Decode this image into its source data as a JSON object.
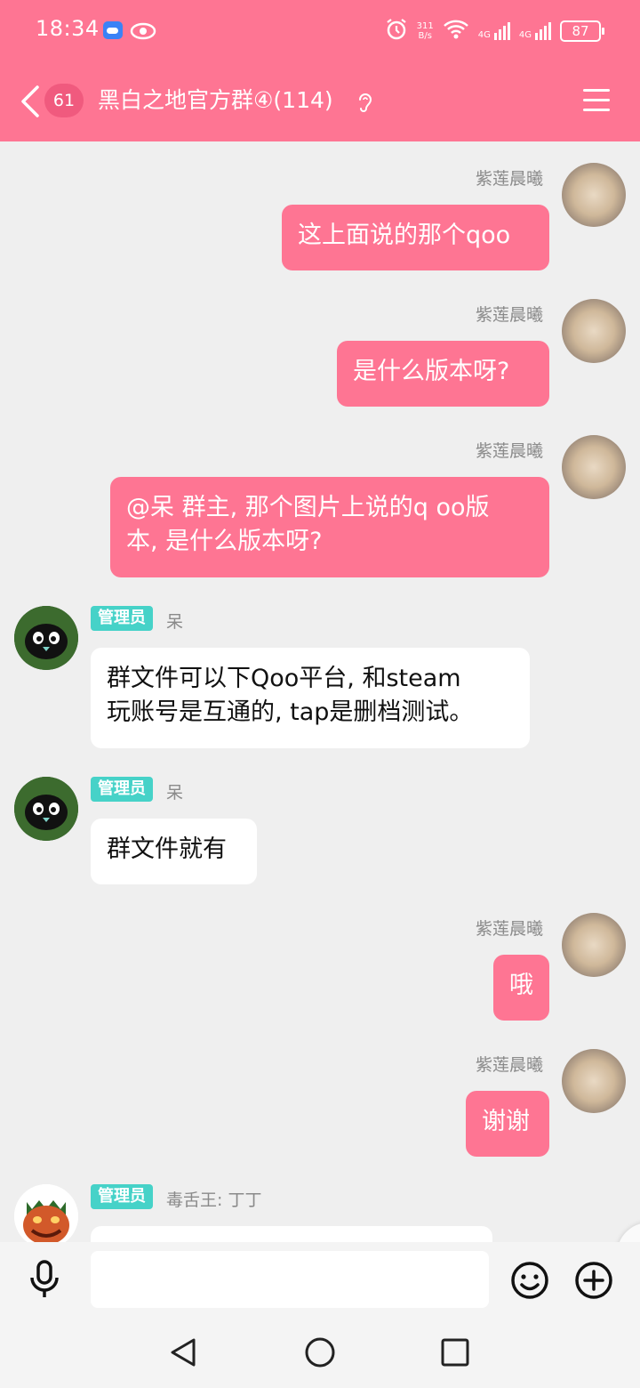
{
  "status": {
    "time": "18:34",
    "net_speed_top": "311",
    "net_speed_bottom": "B/s",
    "battery": "87",
    "sig1": "4G",
    "sig2": "4G"
  },
  "header": {
    "unread": "61",
    "title": "黑白之地官方群④(114)"
  },
  "messages": [
    {
      "side": "right",
      "sender": "紫莲晨曦",
      "text": "这上面说的那个qoo"
    },
    {
      "side": "right",
      "sender": "紫莲晨曦",
      "text": "是什么版本呀?"
    },
    {
      "side": "right",
      "sender": "紫莲晨曦",
      "text": "@呆 群主, 那个图片上说的q oo版\n本, 是什么版本呀?"
    },
    {
      "side": "left",
      "badge": "管理员",
      "sender": "呆",
      "text": "群文件可以下Qoo平台, 和steam\n玩账号是互通的, tap是删档测试。"
    },
    {
      "side": "left",
      "badge": "管理员",
      "sender": "呆",
      "text": "群文件就有"
    },
    {
      "side": "right",
      "sender": "紫莲晨曦",
      "text": "哦"
    },
    {
      "side": "right",
      "sender": "紫莲晨曦",
      "text": "谢谢"
    },
    {
      "side": "left",
      "badge": "管理员",
      "sender": "毒舌王: 丁丁",
      "text": ""
    }
  ],
  "input": {
    "placeholder": ""
  },
  "colors": {
    "accent": "#fe7593",
    "admin_badge": "#46d2c8",
    "background": "#efefef"
  },
  "icons": [
    "back-chevron-icon",
    "ear-icon",
    "menu-icon",
    "mic-icon",
    "emoji-icon",
    "plus-icon",
    "nav-back-icon",
    "nav-home-icon",
    "nav-recents-icon"
  ]
}
